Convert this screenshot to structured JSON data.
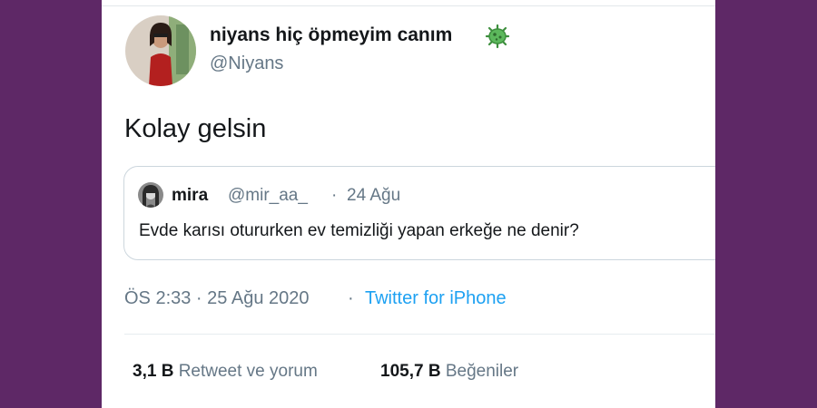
{
  "tweet": {
    "display_name": "niyans hiç öpmeyim canım",
    "emoji_icon": "microbe-icon",
    "handle": "@Niyans",
    "text": "Kolay gelsin",
    "quoted": {
      "name": "mira",
      "handle": "@mir_aa_",
      "separator": "·",
      "date": "24 Ağu",
      "text": "Evde karısı otururken ev temizliği yapan erkeğe ne denir?"
    },
    "meta": {
      "time": "ÖS 2:33 · 25 Ağu 2020",
      "separator": "·",
      "source": "Twitter for iPhone"
    },
    "stats": {
      "retweets_count": "3,1 B",
      "retweets_label": "Retweet ve yorum",
      "likes_count": "105,7 B",
      "likes_label": "Beğeniler"
    }
  },
  "colors": {
    "background": "#5e2866",
    "card": "#ffffff",
    "text": "#14171a",
    "secondary": "#657786",
    "link": "#1da1f2",
    "border": "#ccd6dd",
    "emoji": "#4caf50"
  }
}
